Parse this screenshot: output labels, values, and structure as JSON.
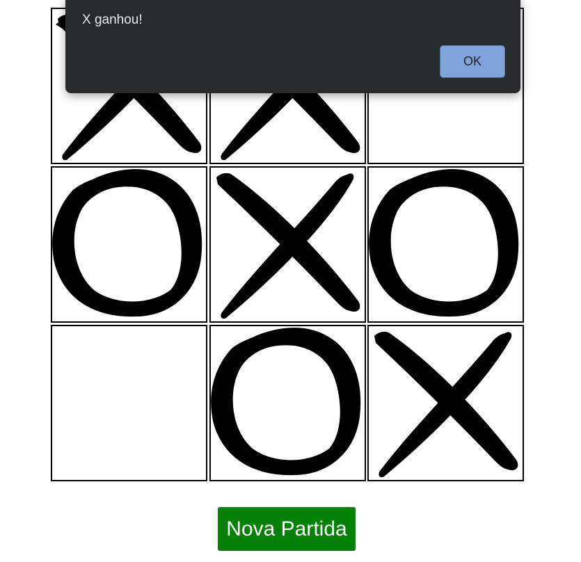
{
  "dialog": {
    "message": "X ganhou!",
    "ok_label": "OK"
  },
  "board": {
    "cells": [
      "X",
      "X",
      "",
      "O",
      "X",
      "O",
      "",
      "O",
      "X"
    ]
  },
  "new_game_label": "Nova Partida",
  "colors": {
    "button_green": "#058105",
    "dialog_bg": "#292a2d",
    "ok_button": "#7fa3da",
    "mark": "#000000"
  }
}
